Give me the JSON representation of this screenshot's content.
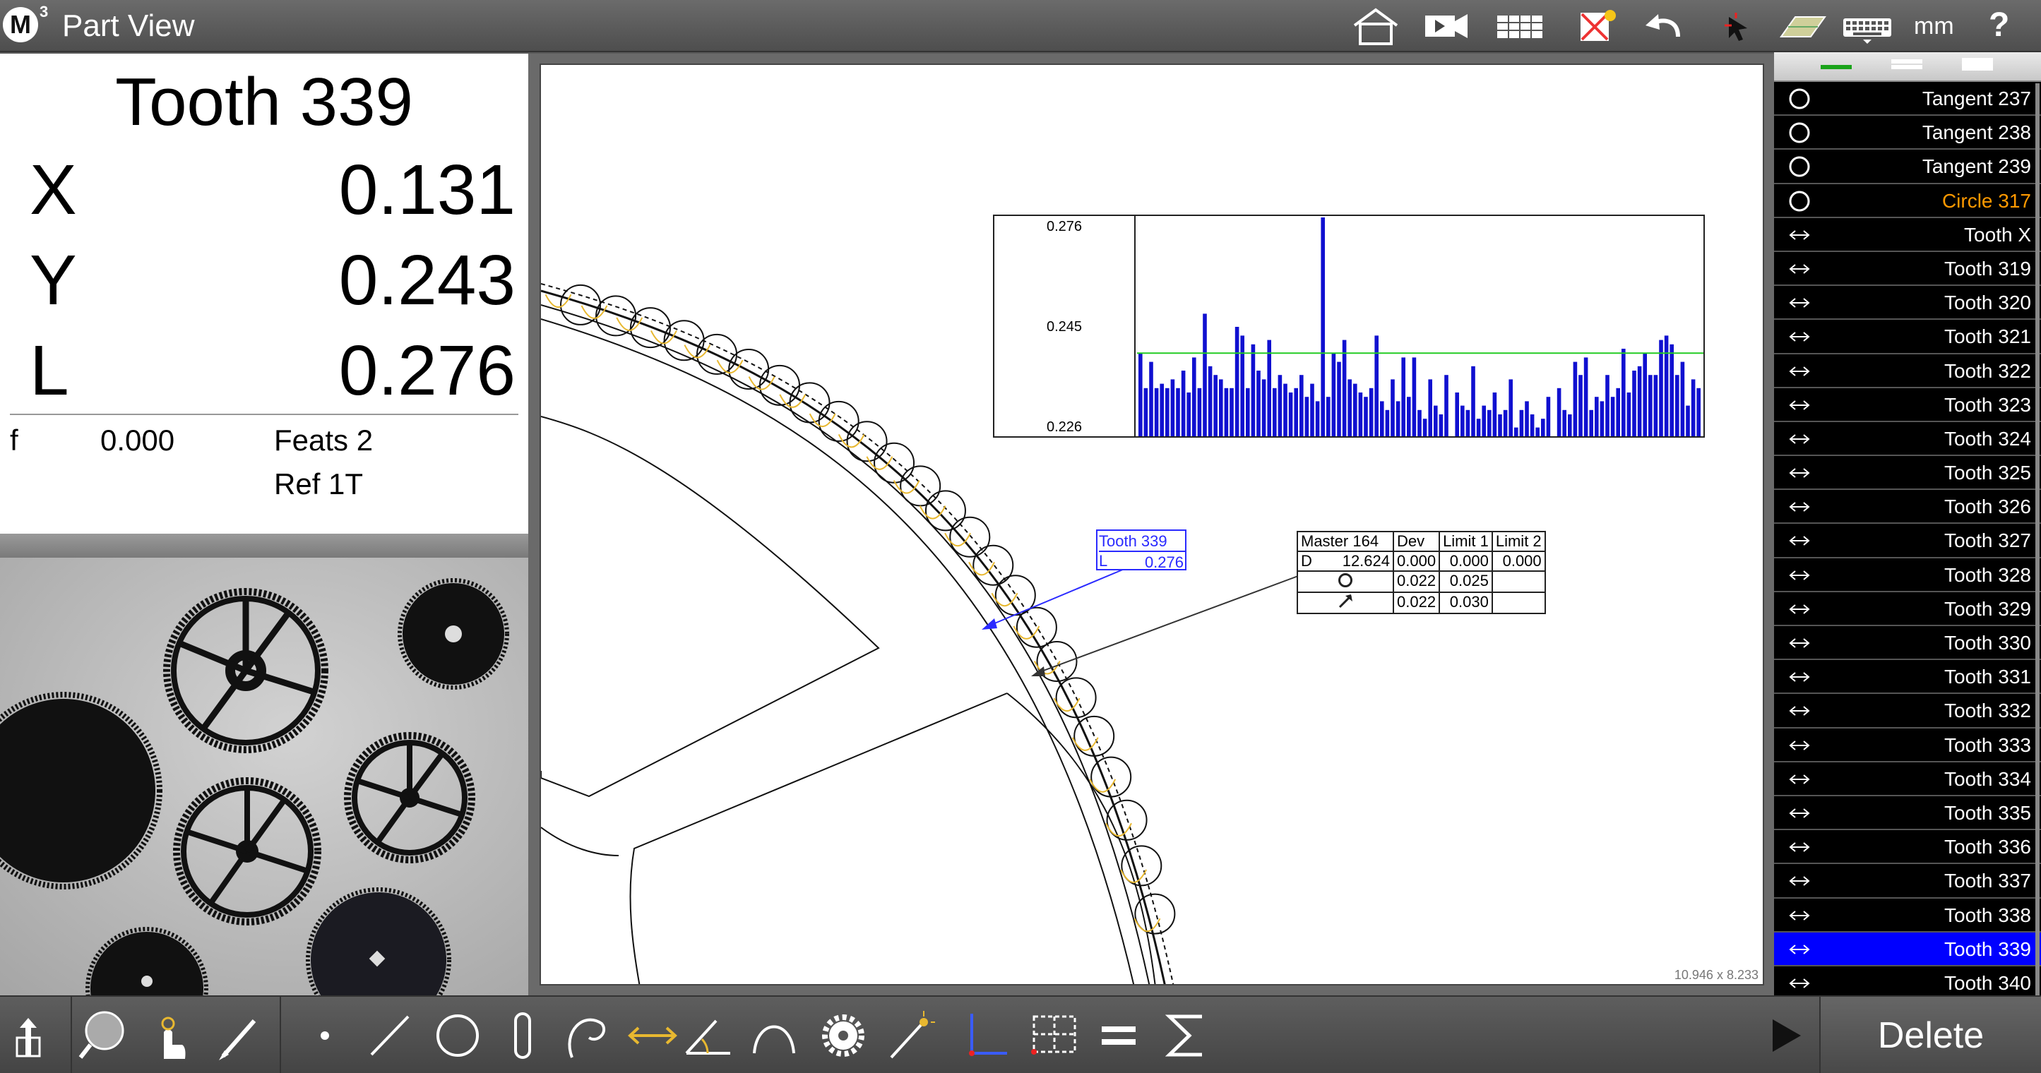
{
  "app": {
    "logo": "M",
    "logo_sup": "3",
    "title": "Part View",
    "unit": "mm",
    "help": "?"
  },
  "toolbar_top": [
    "home-icon",
    "video-camera-icon",
    "grid-table-icon",
    "clear-screen-icon",
    "undo-icon",
    "pointer-zoom-icon",
    "part-stage-icon",
    "keyboard-icon"
  ],
  "dro": {
    "title": "Tooth 339",
    "axes": [
      {
        "label": "X",
        "value": "0.131"
      },
      {
        "label": "Y",
        "value": "0.243"
      },
      {
        "label": "L",
        "value": "0.276"
      }
    ],
    "f_label": "f",
    "f_value": "0.000",
    "feats": "Feats 2",
    "ref": "Ref 1T"
  },
  "canvas": {
    "size_label": "10.946 x 8.233"
  },
  "histogram": {
    "ticks": [
      "0.276",
      "0.245",
      "0.226"
    ],
    "bar_color": "#1010d0",
    "ref_line_color": "#22cc22"
  },
  "chart_data": {
    "type": "bar",
    "ylim": [
      0.226,
      0.276
    ],
    "reference": 0.245,
    "values": [
      0.245,
      0.237,
      0.243,
      0.237,
      0.238,
      0.237,
      0.239,
      0.237,
      0.241,
      0.236,
      0.244,
      0.237,
      0.254,
      0.242,
      0.24,
      0.239,
      0.237,
      0.237,
      0.251,
      0.249,
      0.237,
      0.247,
      0.241,
      0.239,
      0.248,
      0.237,
      0.24,
      0.238,
      0.236,
      0.237,
      0.24,
      0.235,
      0.238,
      0.234,
      0.277,
      0.235,
      0.245,
      0.243,
      0.248,
      0.239,
      0.238,
      0.236,
      0.235,
      0.237,
      0.249,
      0.234,
      0.232,
      0.239,
      0.234,
      0.244,
      0.235,
      0.244,
      0.232,
      0.23,
      0.239,
      0.233,
      0.231,
      0.24,
      0.226,
      0.236,
      0.233,
      0.232,
      0.242,
      0.23,
      0.233,
      0.232,
      0.236,
      0.231,
      0.232,
      0.239,
      0.228,
      0.232,
      0.234,
      0.231,
      0.228,
      0.23,
      0.235,
      0.226,
      0.237,
      0.232,
      0.231,
      0.243,
      0.24,
      0.244,
      0.232,
      0.235,
      0.234,
      0.24,
      0.235,
      0.237,
      0.246,
      0.236,
      0.241,
      0.242,
      0.245,
      0.24,
      0.24,
      0.248,
      0.249,
      0.247,
      0.24,
      0.243,
      0.233,
      0.239,
      0.237
    ]
  },
  "callout": {
    "title": "Tooth 339",
    "label": "L",
    "value": "0.276"
  },
  "result_table": {
    "headers": [
      "Master 164",
      "Dev",
      "Limit 1",
      "Limit 2"
    ],
    "rows": [
      [
        "D",
        "12.624",
        "0.000",
        "0.000",
        "0.000"
      ],
      [
        "",
        "",
        "0.022",
        "0.025",
        ""
      ],
      [
        "",
        "",
        "0.022",
        "0.030",
        ""
      ]
    ]
  },
  "feature_list": [
    {
      "icon": "circle-icon",
      "label": "Tangent 237"
    },
    {
      "icon": "circle-icon",
      "label": "Tangent 238"
    },
    {
      "icon": "circle-icon",
      "label": "Tangent 239"
    },
    {
      "icon": "circle-icon",
      "label": "Circle 317",
      "highlight": "orange"
    },
    {
      "icon": "distance-icon",
      "label": "Tooth X"
    },
    {
      "icon": "distance-icon",
      "label": "Tooth 319"
    },
    {
      "icon": "distance-icon",
      "label": "Tooth 320"
    },
    {
      "icon": "distance-icon",
      "label": "Tooth 321"
    },
    {
      "icon": "distance-icon",
      "label": "Tooth 322"
    },
    {
      "icon": "distance-icon",
      "label": "Tooth 323"
    },
    {
      "icon": "distance-icon",
      "label": "Tooth 324"
    },
    {
      "icon": "distance-icon",
      "label": "Tooth 325"
    },
    {
      "icon": "distance-icon",
      "label": "Tooth 326"
    },
    {
      "icon": "distance-icon",
      "label": "Tooth 327"
    },
    {
      "icon": "distance-icon",
      "label": "Tooth 328"
    },
    {
      "icon": "distance-icon",
      "label": "Tooth 329"
    },
    {
      "icon": "distance-icon",
      "label": "Tooth 330"
    },
    {
      "icon": "distance-icon",
      "label": "Tooth 331"
    },
    {
      "icon": "distance-icon",
      "label": "Tooth 332"
    },
    {
      "icon": "distance-icon",
      "label": "Tooth 333"
    },
    {
      "icon": "distance-icon",
      "label": "Tooth 334"
    },
    {
      "icon": "distance-icon",
      "label": "Tooth 335"
    },
    {
      "icon": "distance-icon",
      "label": "Tooth 336"
    },
    {
      "icon": "distance-icon",
      "label": "Tooth 337"
    },
    {
      "icon": "distance-icon",
      "label": "Tooth 338"
    },
    {
      "icon": "distance-icon",
      "label": "Tooth 339",
      "selected": true
    },
    {
      "icon": "distance-icon",
      "label": "Tooth 340"
    }
  ],
  "bottom_tools": [
    "datum-icon",
    "magnifier-icon",
    "touch-probe-icon",
    "pen-icon",
    "point-icon",
    "line-icon",
    "circle-icon",
    "slot-icon",
    "arc-icon",
    "distance-icon",
    "angle-icon",
    "arc-curve-icon",
    "gear-icon",
    "magic-wand-icon",
    "skew-icon",
    "crosshatch-icon",
    "equals-icon",
    "sigma-icon"
  ],
  "actions": {
    "delete": "Delete",
    "play": "play-icon"
  },
  "colors": {
    "accent": "#0000ff",
    "highlight": "#ff9900",
    "toolbar_icon": "#e8b830"
  }
}
